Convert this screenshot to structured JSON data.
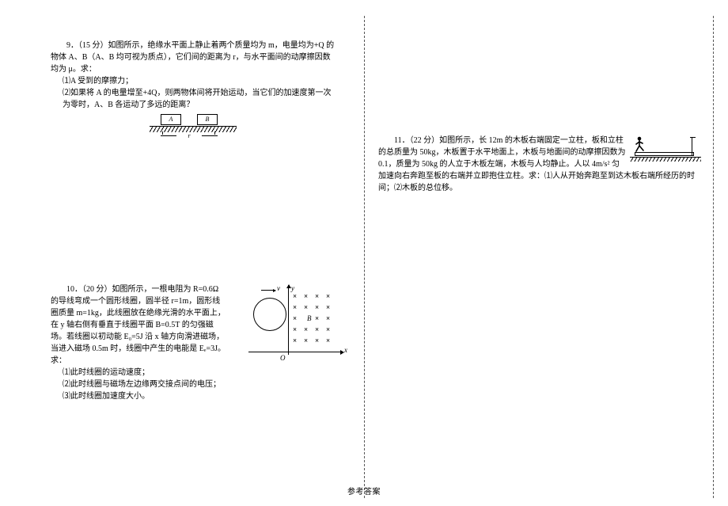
{
  "q9": {
    "intro": "9．（15 分）如图所示，绝缘水平面上静止着两个质量均为 m，电量均为+Q 的物体 A、B（A、B 均可视为质点），它们间的距离为 r，与水平面间的动摩擦因数均为 μ。求：",
    "s1": "⑴A 受到的摩擦力；",
    "s2": "⑵如果将 A 的电量增至+4Q，则两物体间将开始运动，当它们的加速度第一次为零时，A、B 各运动了多远的距离？",
    "labelA": "A",
    "labelB": "B",
    "dim": "r"
  },
  "q10": {
    "intro": "10．（20 分）如图所示，一根电阻为 R=0.6Ω 的导线弯成一个圆形线圈，圆半径 r=1m，圆形线圈质量 m=1kg，此线圈放在绝缘光滑的水平面上，在 y 轴右侧有垂直于线圈平面 B=0.5T 的匀强磁场。若线圈以初动能 E₀=5J 沿 x 轴方向滑进磁场，当进入磁场 0.5m 时，线圈中产生的电能是 Eₑ=3J。求：",
    "s1": "⑴此时线圈的运动速度；",
    "s2": "⑵此时线圈与磁场左边缘两交接点间的电压；",
    "s3": "⑶此时线圈加速度大小。",
    "vlabel": "v",
    "olabel": "O",
    "blabel": "B",
    "xlabel": "x",
    "ylabel": "y"
  },
  "q11": {
    "intro": "11．（22 分）如图所示，长 12m 的木板右端固定一立柱，板和立柱的总质量为 50kg，木板置于水平地面上，木板与地面间的动摩擦因数为 0.1，质量为 50kg 的人立于木板左端，木板与人均静止。人以 4m/s² 匀加速向右奔跑至板的右端并立即抱住立柱。求：⑴人从开始奔跑至到达木板右端所经历的时间；⑵木板的总位移。"
  },
  "answerKey": "参考答案"
}
